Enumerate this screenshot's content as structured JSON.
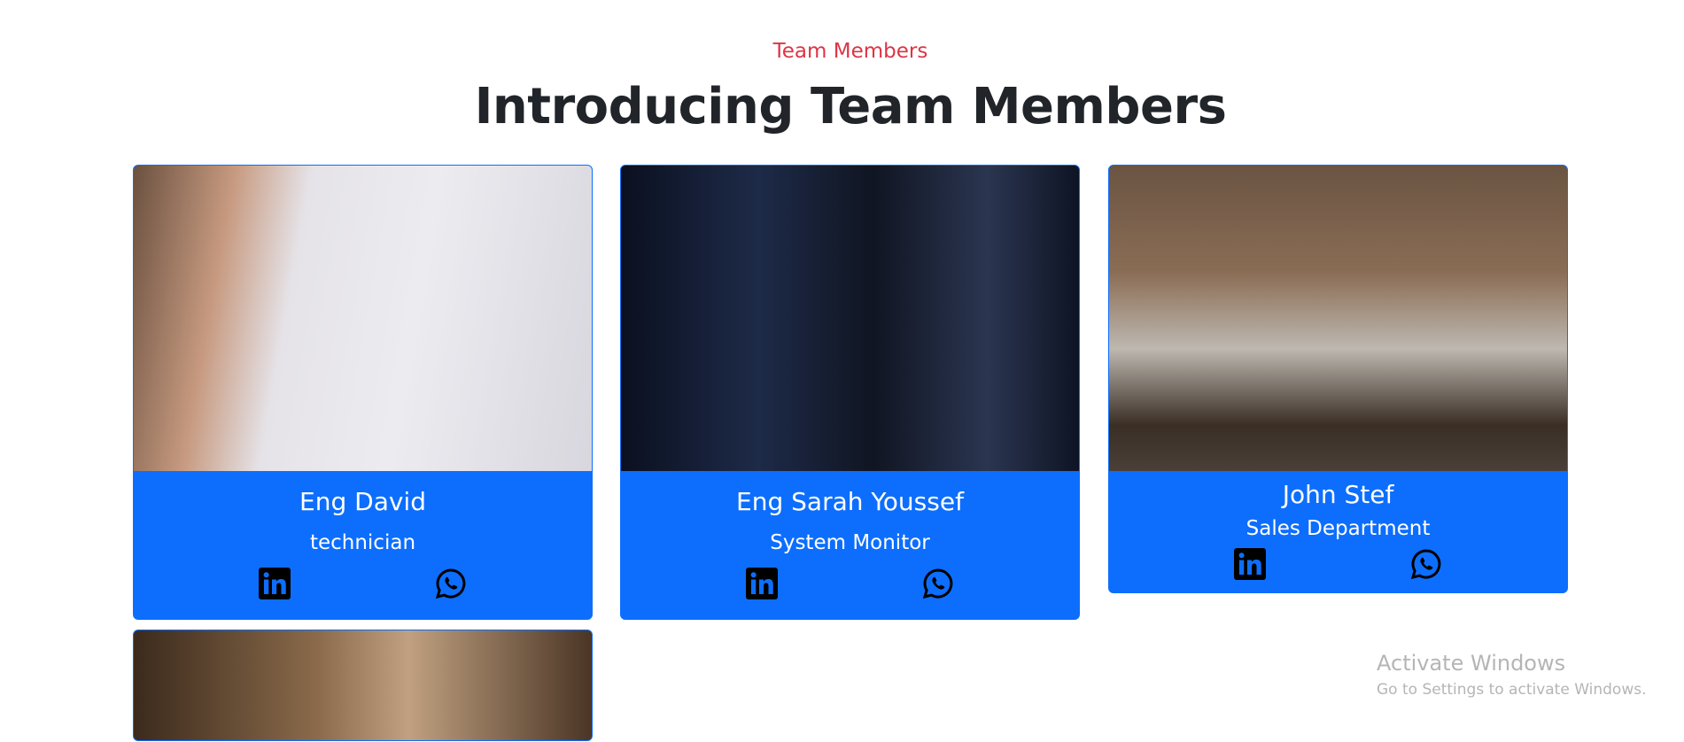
{
  "header": {
    "eyebrow": "Team Members",
    "title": "Introducing Team Members"
  },
  "members": [
    {
      "name": "Eng David",
      "role": "technician"
    },
    {
      "name": "Eng Sarah Youssef",
      "role": "System Monitor"
    },
    {
      "name": "John Stef",
      "role": "Sales Department"
    }
  ],
  "watermark": {
    "title": "Activate Windows",
    "subtitle": "Go to Settings to activate Windows."
  },
  "colors": {
    "card": "#0d6efd",
    "eyebrow": "#dc3545"
  }
}
